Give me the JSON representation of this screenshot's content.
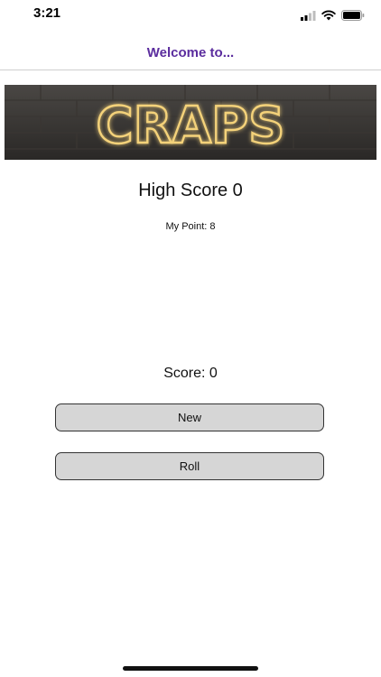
{
  "status_bar": {
    "time": "3:21",
    "icons": [
      "cellular-signal-icon",
      "wifi-icon",
      "battery-icon"
    ]
  },
  "nav": {
    "title": "Welcome to..."
  },
  "banner": {
    "text": "CRAPS"
  },
  "game": {
    "high_score": "High Score 0",
    "my_point": "My Point: 8",
    "score": "Score: 0"
  },
  "buttons": {
    "new_label": "New",
    "roll_label": "Roll"
  },
  "colors": {
    "nav_title": "#5b2d9e",
    "button_bg": "#d6d6d6",
    "neon_glow": "#f4d27a"
  }
}
